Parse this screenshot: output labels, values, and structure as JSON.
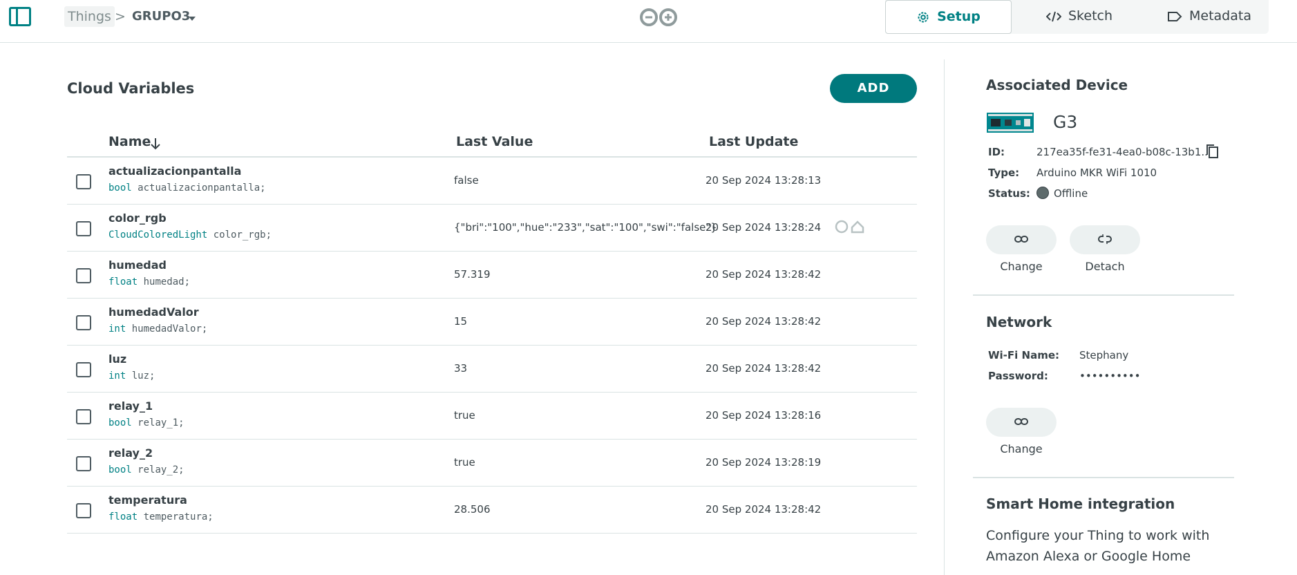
{
  "header": {
    "breadcrumb_root": "Things",
    "breadcrumb_separator": ">",
    "thing_name": "GRUPO3",
    "tabs": [
      {
        "label": "Setup",
        "icon": "gear-icon",
        "active": true
      },
      {
        "label": "Sketch",
        "icon": "code-icon",
        "active": false
      },
      {
        "label": "Metadata",
        "icon": "tag-icon",
        "active": false
      }
    ]
  },
  "variables": {
    "title": "Cloud Variables",
    "add_label": "ADD",
    "columns": {
      "name": "Name",
      "last_value": "Last Value",
      "last_update": "Last Update"
    },
    "rows": [
      {
        "name": "actualizacionpantalla",
        "type": "bool",
        "decl": "actualizacionpantalla;",
        "value": "false",
        "updated": "20 Sep 2024 13:28:13"
      },
      {
        "name": "color_rgb",
        "type": "CloudColoredLight",
        "decl": "color_rgb;",
        "value": "{\"bri\":\"100\",\"hue\":\"233\",\"sat\":\"100\",\"swi\":\"false\"}",
        "updated": "20 Sep 2024 13:28:24"
      },
      {
        "name": "humedad",
        "type": "float",
        "decl": "humedad;",
        "value": "57.319",
        "updated": "20 Sep 2024 13:28:42"
      },
      {
        "name": "humedadValor",
        "type": "int",
        "decl": "humedadValor;",
        "value": "15",
        "updated": "20 Sep 2024 13:28:42"
      },
      {
        "name": "luz",
        "type": "int",
        "decl": "luz;",
        "value": "33",
        "updated": "20 Sep 2024 13:28:42"
      },
      {
        "name": "relay_1",
        "type": "bool",
        "decl": "relay_1;",
        "value": "true",
        "updated": "20 Sep 2024 13:28:16"
      },
      {
        "name": "relay_2",
        "type": "bool",
        "decl": "relay_2;",
        "value": "true",
        "updated": "20 Sep 2024 13:28:19"
      },
      {
        "name": "temperatura",
        "type": "float",
        "decl": "temperatura;",
        "value": "28.506",
        "updated": "20 Sep 2024 13:28:42"
      }
    ]
  },
  "device": {
    "title": "Associated Device",
    "name": "G3",
    "id_label": "ID:",
    "id_value": "217ea35f-fe31-4ea0-b08c-13b1...",
    "type_label": "Type:",
    "type_value": "Arduino MKR WiFi 1010",
    "status_label": "Status:",
    "status_value": "Offline",
    "change_label": "Change",
    "detach_label": "Detach"
  },
  "network": {
    "title": "Network",
    "wifi_label": "Wi-Fi Name:",
    "wifi_value": "Stephany",
    "password_label": "Password:",
    "password_value": "••••••••••",
    "change_label": "Change"
  },
  "smart_home": {
    "title": "Smart Home integration",
    "text": "Configure your Thing to work with Amazon Alexa or Google Home"
  },
  "colors": {
    "accent": "#008184",
    "add_button": "#00797d",
    "status_offline": "#5d6a6b"
  }
}
